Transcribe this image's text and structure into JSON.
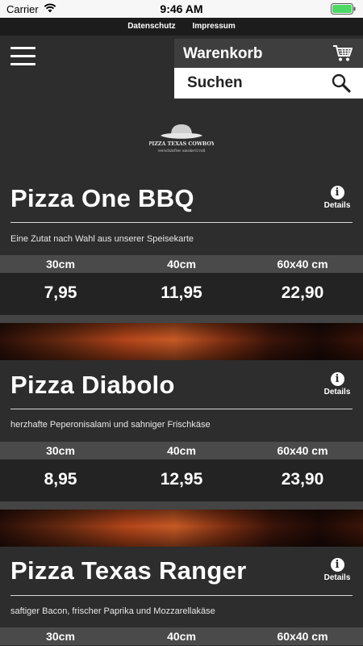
{
  "status_bar": {
    "carrier": "Carrier",
    "time": "9:46 AM"
  },
  "top_links": {
    "privacy": "Datenschutz",
    "imprint": "Impressum"
  },
  "header": {
    "cart_label": "Warenkorb",
    "search_label": "Suchen"
  },
  "logo": {
    "brand": "PIZZA TEXAS COWBOY",
    "tagline": "verschärfter smoke'n'roll"
  },
  "details_label": "Details",
  "size_labels": [
    "30cm",
    "40cm",
    "60x40 cm"
  ],
  "products": [
    {
      "name": "Pizza One BBQ",
      "description": "Eine Zutat nach Wahl aus unserer Speisekarte",
      "prices": [
        "7,95",
        "11,95",
        "22,90"
      ]
    },
    {
      "name": "Pizza Diabolo",
      "description": "herzhafte Peperonisalami und sahniger Frischkäse",
      "prices": [
        "8,95",
        "12,95",
        "23,90"
      ]
    },
    {
      "name": "Pizza Texas Ranger",
      "description": "saftiger Bacon, frischer Paprika und Mozzarellakäse",
      "prices": []
    }
  ],
  "colors": {
    "background": "#2d2d2d",
    "size_row": "#4a4a4a",
    "price_row": "#232323",
    "search_bg": "#ffffff"
  },
  "icons": {
    "menu": "hamburger-icon",
    "cart": "cart-icon",
    "search": "search-icon",
    "details": "info-icon"
  }
}
